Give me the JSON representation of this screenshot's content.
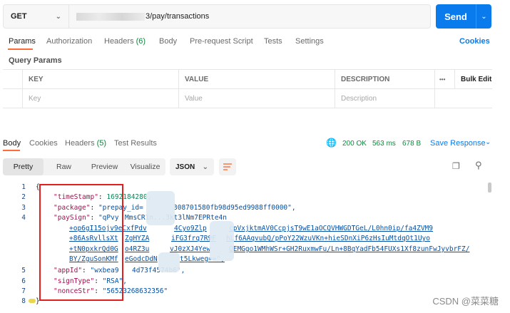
{
  "request": {
    "method": "GET",
    "url_suffix": "3/pay/transactions",
    "send_label": "Send"
  },
  "request_tabs": [
    {
      "label": "Params",
      "active": true
    },
    {
      "label": "Authorization"
    },
    {
      "label": "Headers",
      "count": "(6)"
    },
    {
      "label": "Body"
    },
    {
      "label": "Pre-request Script"
    },
    {
      "label": "Tests"
    },
    {
      "label": "Settings"
    }
  ],
  "cookies_link": "Cookies",
  "query_params": {
    "title": "Query Params",
    "columns": [
      "KEY",
      "VALUE",
      "DESCRIPTION"
    ],
    "more_icon": "•••",
    "bulk_edit": "Bulk Edit",
    "placeholders": [
      "Key",
      "Value",
      "Description"
    ]
  },
  "response_tabs": [
    {
      "label": "Body",
      "active": true
    },
    {
      "label": "Cookies"
    },
    {
      "label": "Headers",
      "count": "(5)"
    },
    {
      "label": "Test Results"
    }
  ],
  "response_status": {
    "status": "200 OK",
    "time": "563 ms",
    "size": "678 B",
    "save_label": "Save Response"
  },
  "view_modes": [
    "Pretty",
    "Raw",
    "Preview",
    "Visualize"
  ],
  "format": "JSON",
  "code": {
    "line_numbers": [
      "1",
      "2",
      "3",
      "4",
      "5",
      "6",
      "7",
      "8"
    ],
    "open_brace": "{",
    "close_brace": "}",
    "timestamp_key": "\"timeStamp\"",
    "timestamp_val": "1692184280,",
    "package_key": "\"package\"",
    "package_val": "\"prepay_id=",
    "package_tail": "308701580fb98d95ed9988ff0000\",",
    "paysign_key": "\"paySign\"",
    "paysign_val": "\"qPvy",
    "paysign_l1_tail": "MmsCR1n...3kt3lNm7EPRte4n",
    "paysign_l2": "+op6gI15ojv9eCxfPdv",
    "paysign_l2_tail": "4Cyo9Zlp",
    "paysign_l2_tail2": "cpVxjktmAV0CcpjsT9wE1aOCQVHWGDTGeL/L0hn0ip/fa4ZVM9",
    "paysign_l3": "+86AsRvllsXt",
    "paysign_l3_mid": "ZgHYZA",
    "paysign_l3_mid2": "iFG3frq7R9F",
    "paysign_l3_tail": "hLf6AAqvubQ/pPoY22WzuVKn+hieSDnXiP6zHsIuMtdqOt1Uyo",
    "paysign_l4": "+tN0pxkrQd0G",
    "paysign_l4_mid": "o4RZ3u",
    "paysign_l4_mid2": "vJ0zXJ4Yew",
    "paysign_l4_tail": "QEMGgo1WMhWSr+GH2RuxmwFu/Ln+8BqYadFb54FUXs1Xf8zunFwJyvbrFZ/",
    "paysign_l5": "BY/ZguSonKMf",
    "paysign_l5_mid": "eGodcDdN",
    "paysign_l5_tail": "t5Lkweg==\",",
    "appid_key": "\"appId\"",
    "appid_val": "\"wxbea9",
    "appid_tail": "4d73f4574b6\",",
    "signtype_key": "\"signType\"",
    "signtype_val": "\"RSA\",",
    "noncestr_key": "\"nonceStr\"",
    "noncestr_val": "\"56523268632356\""
  },
  "watermark": "CSDN @菜菜糖",
  "colors": {
    "send": "#097bed",
    "active_tab_underline": "#ff6c37",
    "status_ok": "#0c8a3c",
    "highlight_box": "#e21e1e"
  }
}
